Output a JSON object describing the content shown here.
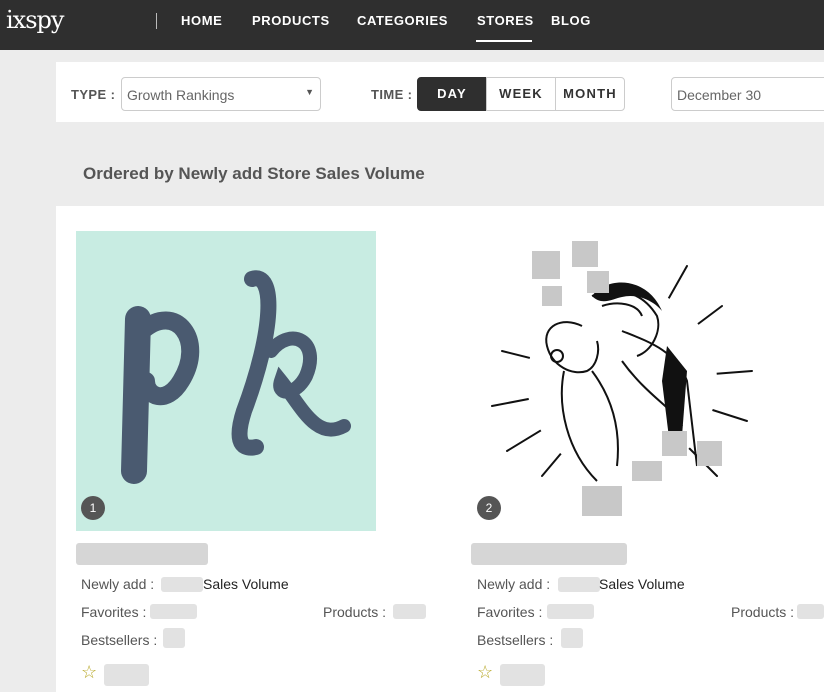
{
  "brand": {
    "logo": "ixspy"
  },
  "nav": {
    "items": [
      {
        "label": "HOME"
      },
      {
        "label": "PRODUCTS"
      },
      {
        "label": "CATEGORIES"
      },
      {
        "label": "STORES"
      },
      {
        "label": "BLOG"
      }
    ],
    "active": "STORES"
  },
  "filters": {
    "type_label": "TYPE :",
    "type_value": "Growth Rankings",
    "time_label": "TIME :",
    "time_options": [
      {
        "label": "DAY",
        "active": true
      },
      {
        "label": "WEEK",
        "active": false
      },
      {
        "label": "MONTH",
        "active": false
      }
    ],
    "date_value": "December 30"
  },
  "section": {
    "title": "Ordered by Newly add Store Sales Volume"
  },
  "stores": [
    {
      "rank": "1",
      "image_text": "pk",
      "newly_add_label": "Newly add :",
      "sales_volume_label": "Sales Volume",
      "favorites_label": "Favorites :",
      "products_label": "Products :",
      "bestsellers_label": "Bestsellers :"
    },
    {
      "rank": "2",
      "newly_add_label": "Newly add :",
      "sales_volume_label": "Sales Volume",
      "favorites_label": "Favorites :",
      "products_label": "Products :",
      "bestsellers_label": "Bestsellers :"
    }
  ],
  "icons": {
    "dropdown": "chevron-down-icon",
    "favorite": "star-outline-icon"
  },
  "colors": {
    "nav_bg": "#2f2f2f",
    "active_segment": "#2f2f2f",
    "card1_bg": "#c8ece2",
    "logo_ink": "#4a5a70",
    "star": "#b8a92a"
  }
}
